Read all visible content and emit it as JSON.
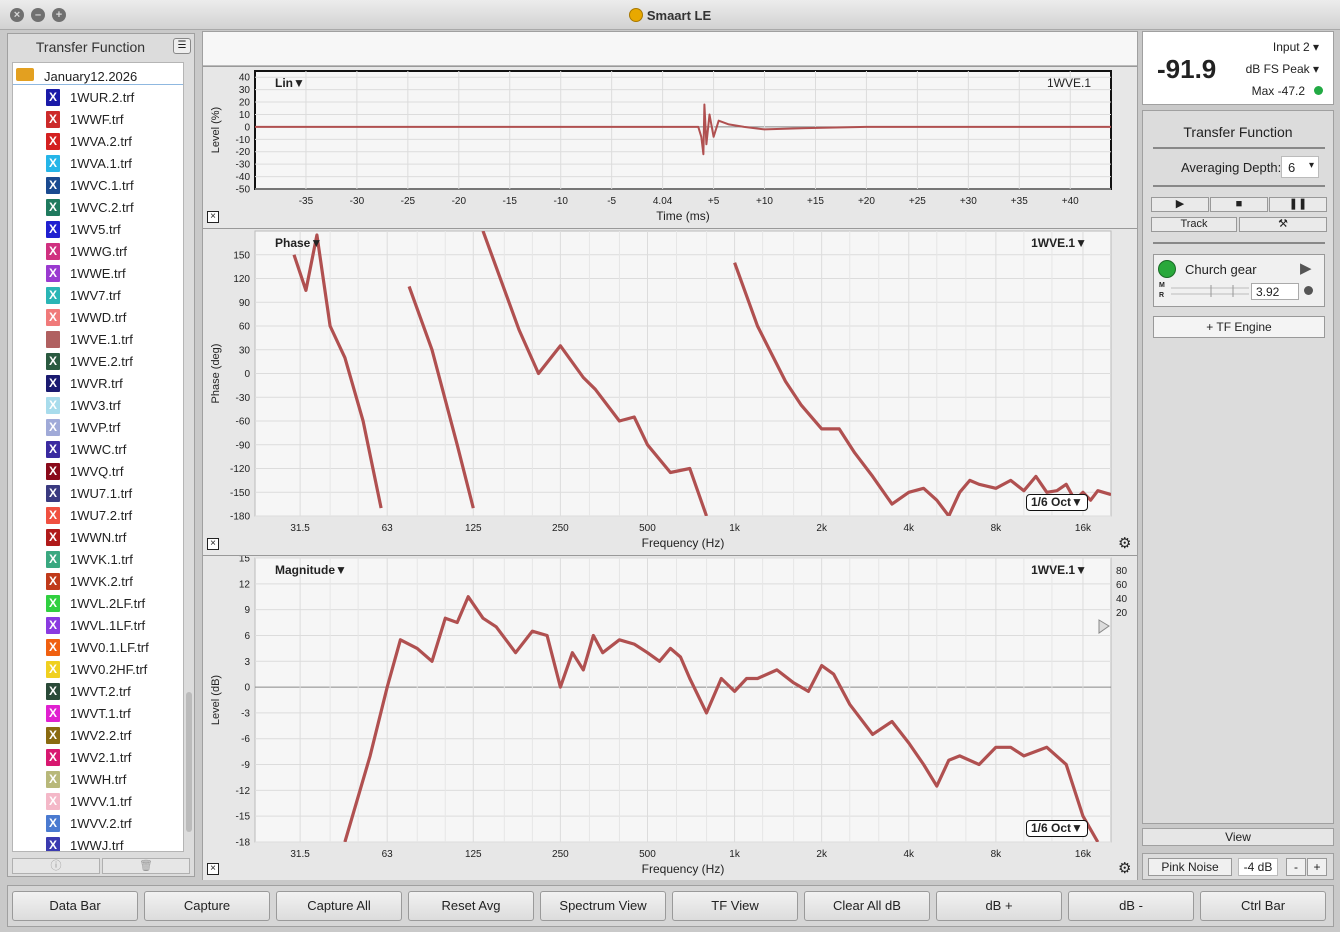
{
  "window": {
    "title": "Smaart LE"
  },
  "left_panel": {
    "title": "Transfer Function",
    "folder": "January12.2026",
    "files": [
      {
        "name": "1WUR.2.trf",
        "color": "#1a1aa8"
      },
      {
        "name": "1WWF.trf",
        "color": "#cc2a2a"
      },
      {
        "name": "1WVA.2.trf",
        "color": "#d42020"
      },
      {
        "name": "1WVA.1.trf",
        "color": "#25b5e8"
      },
      {
        "name": "1WVC.1.trf",
        "color": "#1a4a90"
      },
      {
        "name": "1WVC.2.trf",
        "color": "#1f7a5e"
      },
      {
        "name": "1WV5.trf",
        "color": "#2020d0"
      },
      {
        "name": "1WWG.trf",
        "color": "#d03080"
      },
      {
        "name": "1WWE.trf",
        "color": "#9a3ad0"
      },
      {
        "name": "1WV7.trf",
        "color": "#2ab5b5"
      },
      {
        "name": "1WWD.trf",
        "color": "#f07a7a"
      },
      {
        "name": "1WVE.1.trf",
        "color": "#b06060",
        "plain": true
      },
      {
        "name": "1WVE.2.trf",
        "color": "#2a5a40"
      },
      {
        "name": "1WVR.trf",
        "color": "#1a1a70"
      },
      {
        "name": "1WV3.trf",
        "color": "#a8dcec"
      },
      {
        "name": "1WVP.trf",
        "color": "#a0aad8"
      },
      {
        "name": "1WWC.trf",
        "color": "#3a2aa0"
      },
      {
        "name": "1WVQ.trf",
        "color": "#8a0a1a"
      },
      {
        "name": "1WU7.1.trf",
        "color": "#3a3a80"
      },
      {
        "name": "1WU7.2.trf",
        "color": "#f05040"
      },
      {
        "name": "1WWN.trf",
        "color": "#b01a1a"
      },
      {
        "name": "1WVK.1.trf",
        "color": "#3aa880"
      },
      {
        "name": "1WVK.2.trf",
        "color": "#c03a1a"
      },
      {
        "name": "1WVL.2LF.trf",
        "color": "#30d040"
      },
      {
        "name": "1WVL.1LF.trf",
        "color": "#8a3ae0"
      },
      {
        "name": "1WV0.1.LF.trf",
        "color": "#f06010"
      },
      {
        "name": "1WV0.2HF.trf",
        "color": "#f0d020"
      },
      {
        "name": "1WVT.2.trf",
        "color": "#2a4a38"
      },
      {
        "name": "1WVT.1.trf",
        "color": "#e020d0"
      },
      {
        "name": "1WV2.2.trf",
        "color": "#8a6a10"
      },
      {
        "name": "1WV2.1.trf",
        "color": "#d81870"
      },
      {
        "name": "1WWH.trf",
        "color": "#b8b87a"
      },
      {
        "name": "1WVV.1.trf",
        "color": "#f4b8c8"
      },
      {
        "name": "1WVV.2.trf",
        "color": "#4a7ad0"
      },
      {
        "name": "1WWJ.trf",
        "color": "#3a3ab0"
      }
    ],
    "bottom_icons": [
      "info-icon",
      "trash-icon"
    ]
  },
  "plots": {
    "impulse": {
      "label": "Lin",
      "trace": "1WVE.1",
      "ylabel": "Level (%)",
      "xlabel": "Time (ms)",
      "yticks": [
        "40",
        "30",
        "20",
        "10",
        "0",
        "-10",
        "-20",
        "-30",
        "-40",
        "-50"
      ],
      "xticks": [
        "-35",
        "-30",
        "-25",
        "-20",
        "-15",
        "-10",
        "-5",
        "4.04",
        "+5",
        "+10",
        "+15",
        "+20",
        "+25",
        "+30",
        "+35",
        "+40"
      ]
    },
    "phase": {
      "label": "Phase",
      "trace": "1WVE.1",
      "ylabel": "Phase (deg)",
      "xlabel": "Frequency (Hz)",
      "smoothing": "1/6 Oct",
      "yticks": [
        "150",
        "120",
        "90",
        "60",
        "30",
        "0",
        "-30",
        "-60",
        "-90",
        "-120",
        "-150",
        "-180"
      ],
      "xticks": [
        "31.5",
        "63",
        "125",
        "250",
        "500",
        "1k",
        "2k",
        "4k",
        "8k",
        "16k"
      ]
    },
    "magnitude": {
      "label": "Magnitude",
      "trace": "1WVE.1",
      "ylabel": "Level (dB)",
      "xlabel": "Frequency (Hz)",
      "smoothing": "1/6 Oct",
      "yticks": [
        "15",
        "12",
        "9",
        "6",
        "3",
        "0",
        "-3",
        "-6",
        "-9",
        "-12",
        "-15",
        "-18"
      ],
      "xticks": [
        "31.5",
        "63",
        "125",
        "250",
        "500",
        "1k",
        "2k",
        "4k",
        "8k",
        "16k"
      ],
      "coherence_ticks": [
        "80",
        "60",
        "40",
        "20"
      ]
    }
  },
  "chart_data": [
    {
      "type": "line",
      "title": "Lin",
      "xlabel": "Time (ms)",
      "ylabel": "Level (%)",
      "xlim": [
        -40,
        44
      ],
      "ylim": [
        -50,
        45
      ],
      "series": [
        {
          "name": "1WVE.1",
          "x": [
            -40,
            -30,
            -20,
            -10,
            0,
            3.5,
            3.8,
            4.0,
            4.1,
            4.3,
            4.6,
            5.0,
            5.5,
            6.5,
            8,
            10,
            14,
            20,
            30,
            44
          ],
          "y": [
            0,
            0,
            0,
            0,
            0,
            0,
            -8,
            -22,
            18,
            -14,
            10,
            -8,
            5,
            2,
            0,
            -2,
            -1,
            0,
            0,
            0
          ]
        }
      ]
    },
    {
      "type": "line",
      "title": "Phase",
      "xlabel": "Frequency (Hz)",
      "ylabel": "Phase (deg)",
      "xscale": "log",
      "xlim": [
        22,
        20000
      ],
      "ylim": [
        -180,
        180
      ],
      "series": [
        {
          "name": "1WVE.1",
          "x": [
            30,
            33,
            36,
            40,
            45,
            52,
            60,
            75,
            90,
            110,
            125,
            135,
            180,
            210,
            250,
            300,
            330,
            400,
            450,
            500,
            600,
            700,
            800,
            1000,
            1200,
            1500,
            1700,
            2000,
            2300,
            2600,
            3000,
            3500,
            4000,
            4500,
            5000,
            5500,
            6000,
            6500,
            7000,
            8000,
            9000,
            10000,
            11000,
            12000,
            13000,
            14000,
            15000,
            16000,
            17000,
            18000,
            20000
          ],
          "y": [
            150,
            105,
            175,
            60,
            20,
            -60,
            -170,
            110,
            30,
            -90,
            -170,
            180,
            55,
            0,
            35,
            -5,
            -20,
            -60,
            -55,
            -90,
            -125,
            -120,
            -180,
            140,
            60,
            -10,
            -40,
            -70,
            -70,
            -100,
            -130,
            -165,
            -150,
            -145,
            -160,
            -180,
            -150,
            -135,
            -140,
            -145,
            -135,
            -148,
            -130,
            -150,
            -148,
            -140,
            -160,
            -150,
            -160,
            -148,
            -153
          ]
        }
      ]
    },
    {
      "type": "line",
      "title": "Magnitude",
      "xlabel": "Frequency (Hz)",
      "ylabel": "Level (dB)",
      "xscale": "log",
      "xlim": [
        22,
        20000
      ],
      "ylim": [
        -18,
        15
      ],
      "series": [
        {
          "name": "1WVE.1",
          "x": [
            45,
            55,
            63,
            70,
            80,
            90,
            100,
            110,
            120,
            135,
            150,
            175,
            200,
            225,
            250,
            275,
            300,
            325,
            350,
            400,
            450,
            500,
            550,
            600,
            650,
            700,
            800,
            900,
            1000,
            1100,
            1200,
            1400,
            1600,
            1800,
            2000,
            2200,
            2500,
            3000,
            3500,
            4000,
            4500,
            5000,
            5500,
            6000,
            7000,
            8000,
            9000,
            10000,
            12000,
            14000,
            16000,
            18000
          ],
          "y": [
            -18,
            -8,
            0,
            5.5,
            4.5,
            3,
            8,
            7.5,
            10.5,
            8,
            7,
            4,
            6.5,
            6,
            0,
            4,
            2,
            6,
            4,
            5.5,
            5,
            4,
            3,
            4.5,
            3.5,
            1,
            -3,
            1,
            -0.5,
            1,
            1,
            2,
            0.5,
            -0.5,
            2.5,
            1.5,
            -2,
            -5.5,
            -4,
            -6.5,
            -9,
            -11.5,
            -8.5,
            -8,
            -9,
            -7,
            -7,
            -8,
            -7,
            -9,
            -15,
            -18
          ]
        }
      ]
    }
  ],
  "meter": {
    "value": "-91.9",
    "input": "Input 2",
    "unit": "dB FS Peak",
    "max": "Max -47.2",
    "status_color": "#22aa44"
  },
  "right_panel": {
    "title": "Transfer Function",
    "avg_label": "Averaging Depth:",
    "avg_value": "6",
    "transport": [
      "play-icon",
      "stop-icon",
      "pause-icon"
    ],
    "track_label": "Track",
    "tools_icon": "tools-icon",
    "engine": {
      "name": "Church gear",
      "m": "M",
      "r": "R",
      "delay": "3.92"
    },
    "tf_engine_label": "+ TF Engine",
    "view_label": "View",
    "pink_noise_label": "Pink Noise",
    "noise_level": "-4 dB",
    "noise_minus": "-",
    "noise_plus": "+"
  },
  "bottom_bar": [
    "Data Bar",
    "Capture",
    "Capture All",
    "Reset Avg",
    "Spectrum View",
    "TF View",
    "Clear All dB",
    "dB +",
    "dB -",
    "Ctrl Bar"
  ],
  "trace_color": "#b05050"
}
